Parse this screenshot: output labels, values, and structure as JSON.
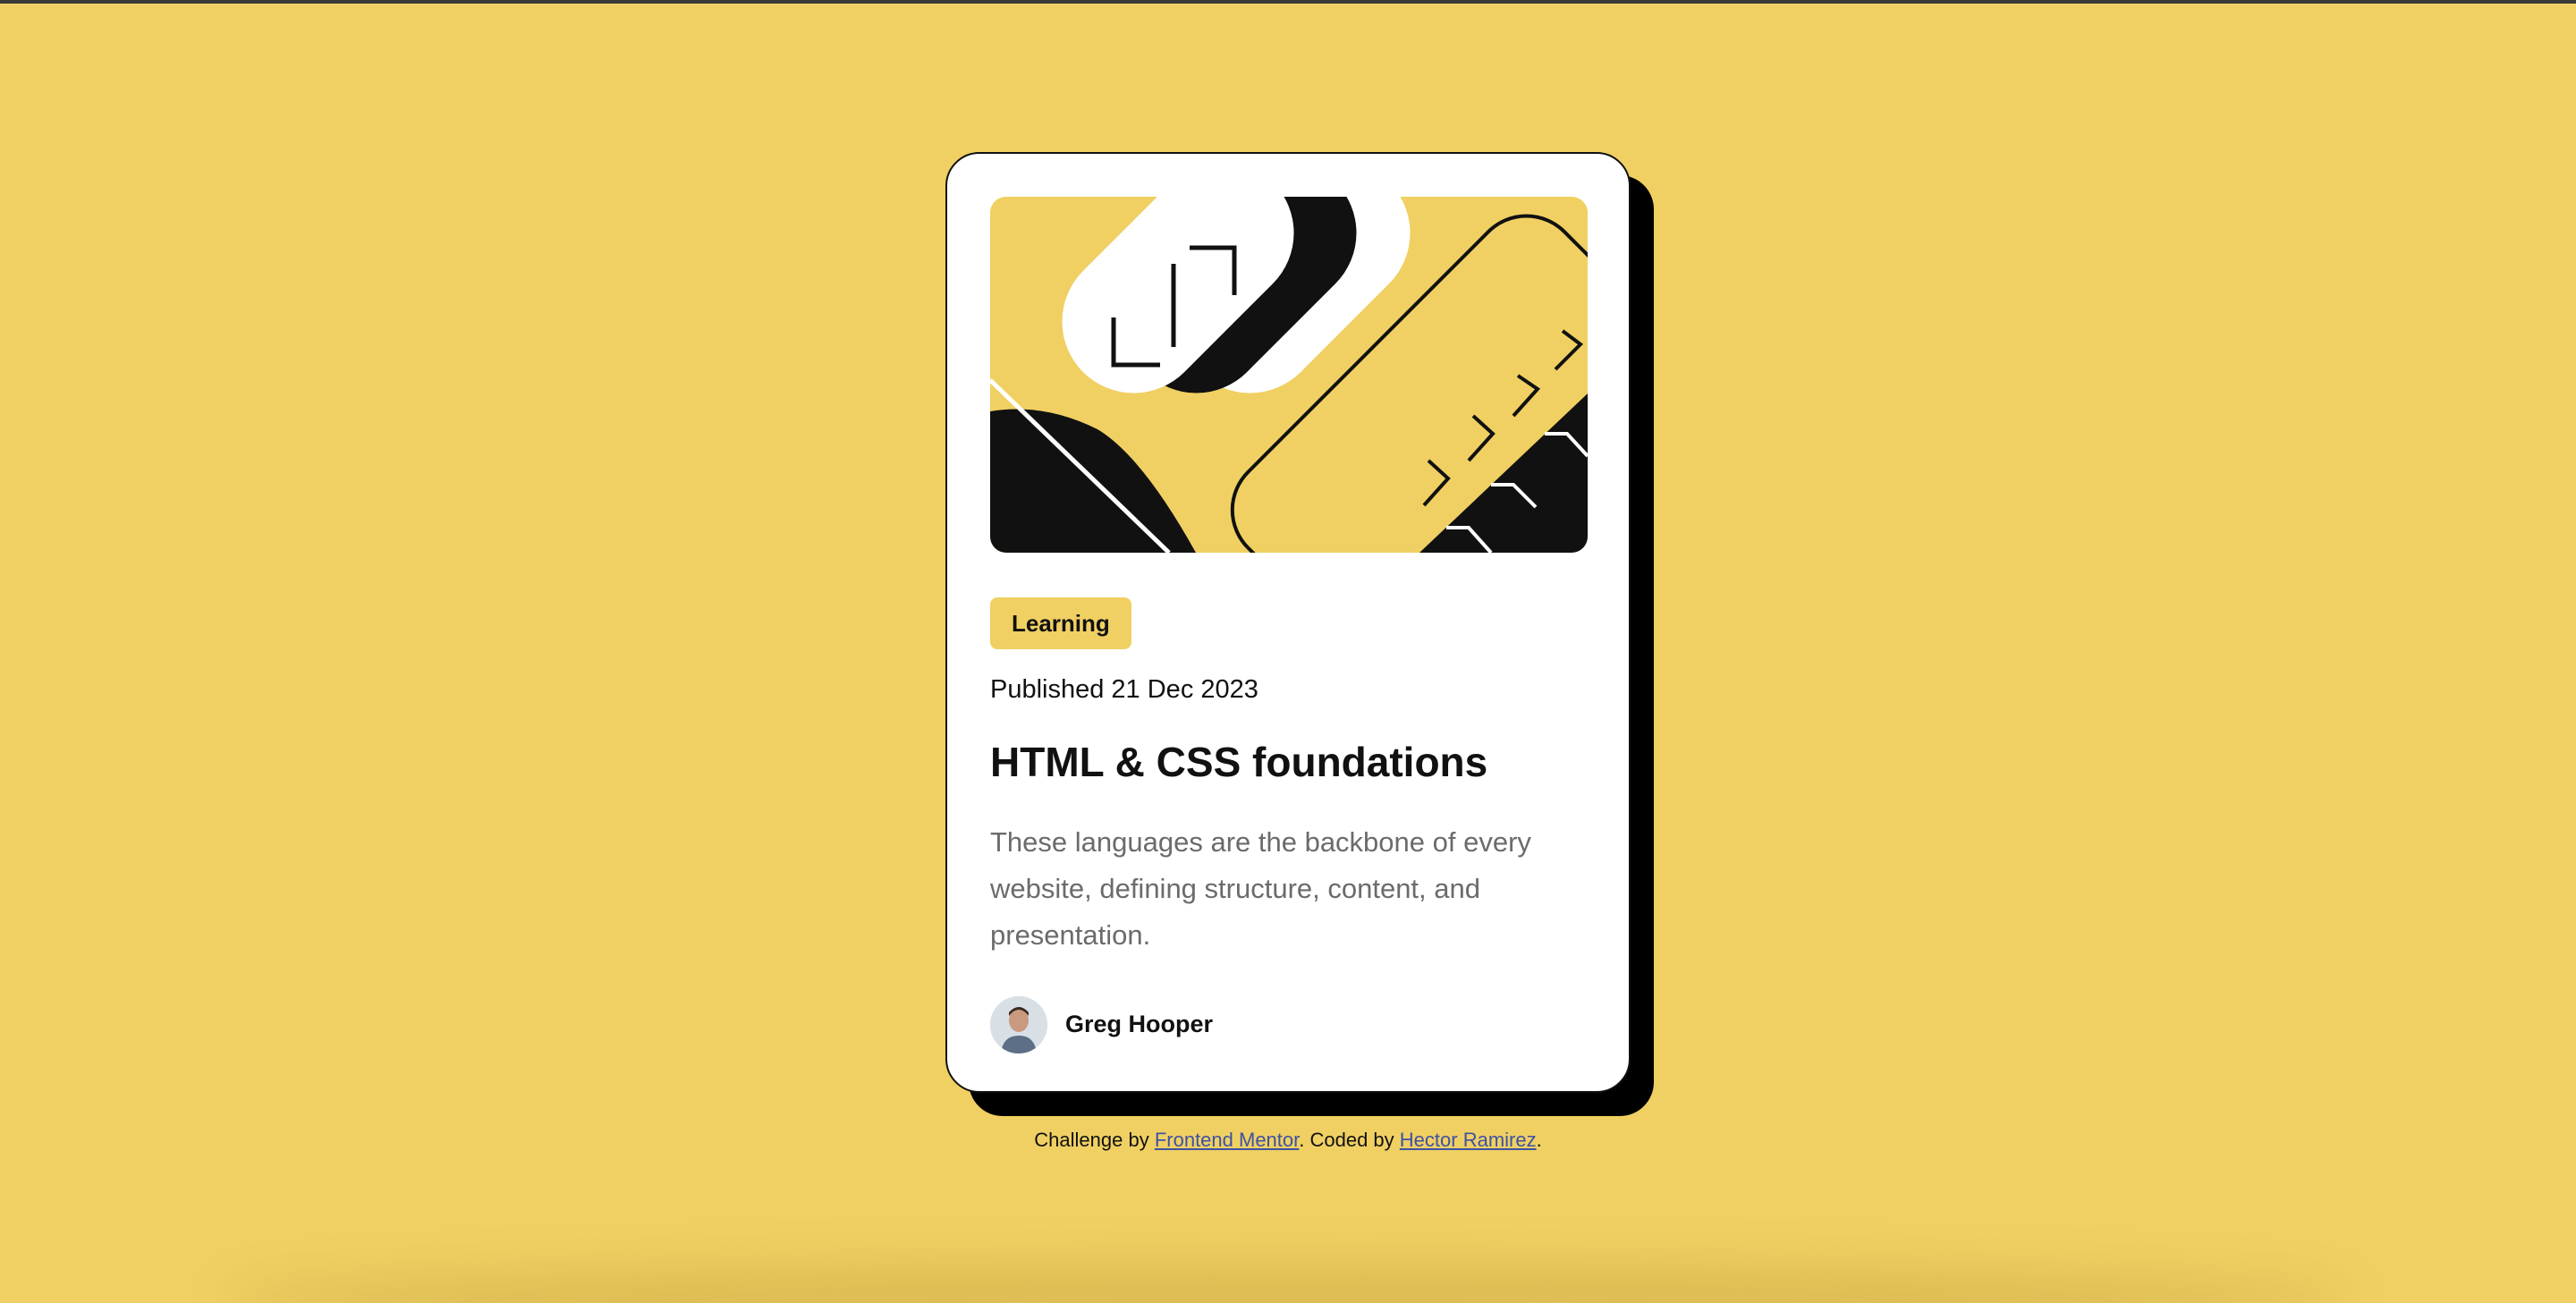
{
  "colors": {
    "background": "#F0D062",
    "card": "#FFFFFF",
    "text": "#111111",
    "muted": "#6B6B6B",
    "link": "#3E52A3"
  },
  "card": {
    "image_alt": "illustration-article",
    "tag": "Learning",
    "published": "Published 21 Dec 2023",
    "title": "HTML & CSS foundations",
    "description": "These languages are the backbone of every website, defining structure, content, and presentation.",
    "author": {
      "name": "Greg Hooper",
      "avatar_icon": "avatar-photo"
    }
  },
  "attribution": {
    "prefix": "Challenge by ",
    "link1": "Frontend Mentor",
    "middle": ". Coded by ",
    "link2": "Hector Ramirez",
    "suffix": "."
  }
}
